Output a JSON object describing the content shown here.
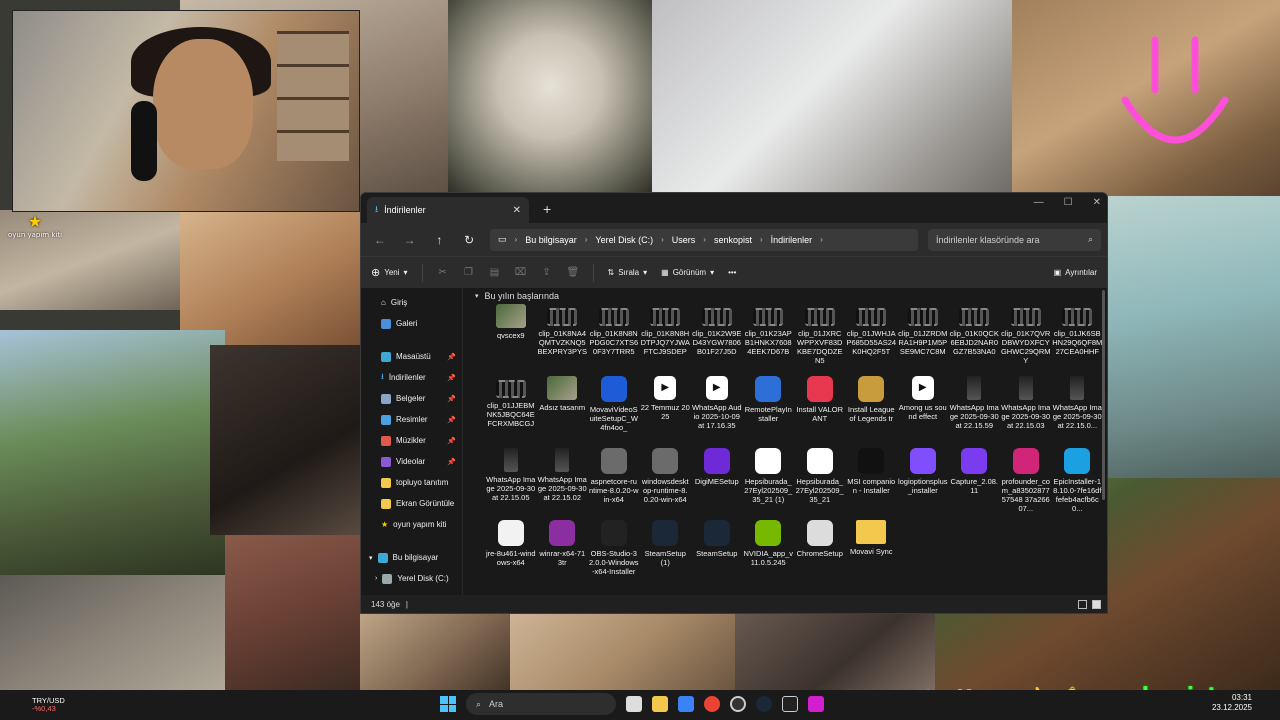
{
  "overlay": {
    "star_label": "oyun yapım kiti",
    "social_handle": "senkopist"
  },
  "window": {
    "tab_title": "İndirilenler",
    "address": [
      "Bu bilgisayar",
      "Yerel Disk (C:)",
      "Users",
      "senkopist",
      "İndirilenler"
    ],
    "search_placeholder": "İndirilenler klasöründe ara"
  },
  "toolbar": {
    "new_label": "Yeni",
    "sort_label": "Sırala",
    "view_label": "Görünüm",
    "more_label": "•••",
    "details_label": "Ayrıntılar"
  },
  "sidebar": {
    "items": [
      {
        "label": "Giriş",
        "icon": "home-icon"
      },
      {
        "label": "Galeri",
        "icon": "gallery-icon"
      },
      {
        "label": "Masaüstü",
        "icon": "desktop-icon",
        "pinned": true
      },
      {
        "label": "İndirilenler",
        "icon": "download-icon",
        "pinned": true
      },
      {
        "label": "Belgeler",
        "icon": "documents-icon",
        "pinned": true
      },
      {
        "label": "Resimler",
        "icon": "pictures-icon",
        "pinned": true
      },
      {
        "label": "Müzikler",
        "icon": "music-icon",
        "pinned": true
      },
      {
        "label": "Videolar",
        "icon": "videos-icon",
        "pinned": true
      },
      {
        "label": "topluyo tanıtım",
        "icon": "folder-icon"
      },
      {
        "label": "Ekran Görüntüle",
        "icon": "folder-icon"
      },
      {
        "label": "oyun yapım kiti",
        "icon": "star-icon"
      },
      {
        "label": "Bu bilgisayar",
        "icon": "computer-icon"
      },
      {
        "label": "Yerel Disk (C:)",
        "icon": "drive-icon"
      }
    ]
  },
  "files": {
    "group_header": "Bu yılın başlarında",
    "items": [
      {
        "name": "qvscex9",
        "type": "photo"
      },
      {
        "name": "clip_01K8NA4QMTVZKNQ5BEXPRY3PYS",
        "type": "video"
      },
      {
        "name": "clip_01K8N8NPDG0C7XTS60F3Y7TRR5",
        "type": "video"
      },
      {
        "name": "clip_01K8N8HDTPJQ7YJWAFTCJ9SDEP",
        "type": "video"
      },
      {
        "name": "clip_01K2W9ED43YGW7806B01F27J5D",
        "type": "video"
      },
      {
        "name": "clip_01K23APB1HNKX76084EEK7D67B",
        "type": "video"
      },
      {
        "name": "clip_01JXRCWPPXVF83DKBE7DQDZEN5",
        "type": "video"
      },
      {
        "name": "clip_01JWHJAP685D55AS24K0HQ2F5T",
        "type": "video"
      },
      {
        "name": "clip_01JZRDMRA1H9P1M5PSE9MC7C8M",
        "type": "video"
      },
      {
        "name": "clip_01K0QCK6EBJD2NAR0GZ7B53NA0",
        "type": "video"
      },
      {
        "name": "clip_01K7QVRDBWYDXFCYGHWC29QRMY",
        "type": "video"
      },
      {
        "name": "clip_01JK6SBHN29Q6QF8M27CEA0HHF",
        "type": "video"
      },
      {
        "name": "clip_01JJEBMNK5JBQC64EFCRXMBCGJ",
        "type": "video"
      },
      {
        "name": "Adsız tasarım",
        "type": "photo"
      },
      {
        "name": "MovaviVideoSuiteSetupC_W4fn4oo_",
        "type": "app",
        "color": "#1e5bd6"
      },
      {
        "name": "22 Temmuz 2025",
        "type": "play"
      },
      {
        "name": "WhatsApp Audio 2025-10-09 at 17.16.35",
        "type": "play"
      },
      {
        "name": "RemotePlayInstaller",
        "type": "app",
        "color": "#2d6fd6"
      },
      {
        "name": "Install VALORANT",
        "type": "app",
        "color": "#e8384f"
      },
      {
        "name": "Install League of Legends tr",
        "type": "app",
        "color": "#c89b3c"
      },
      {
        "name": "Among us sound effect",
        "type": "play"
      },
      {
        "name": "WhatsApp Image 2025-09-30 at 22.15.59",
        "type": "phone"
      },
      {
        "name": "WhatsApp Image 2025-09-30 at 22.15.03",
        "type": "phone"
      },
      {
        "name": "WhatsApp Image 2025-09-30 at 22.15.0...",
        "type": "phone"
      },
      {
        "name": "WhatsApp Image 2025-09-30 at 22.15.05",
        "type": "phone"
      },
      {
        "name": "WhatsApp Image 2025-09-30 at 22.15.02",
        "type": "phone"
      },
      {
        "name": "aspnetcore-runtime-8.0.20-win-x64",
        "type": "app",
        "color": "#6b6b6b"
      },
      {
        "name": "windowsdesktop-runtime-8.0.20-win-x64",
        "type": "app",
        "color": "#6b6b6b"
      },
      {
        "name": "DigiMESetup",
        "type": "app",
        "color": "#6d2ad6"
      },
      {
        "name": "Hepsiburada_27Eyl202509_35_21 (1)",
        "type": "app",
        "color": "#ffffff"
      },
      {
        "name": "Hepsiburada_27Eyl202509_35_21",
        "type": "app",
        "color": "#ffffff"
      },
      {
        "name": "MSI companion - Installer",
        "type": "app",
        "color": "#111111"
      },
      {
        "name": "logioptionsplus_installer",
        "type": "app",
        "color": "#814eff"
      },
      {
        "name": "Capture_2.08.11",
        "type": "app",
        "color": "#7b3cf0"
      },
      {
        "name": "profounder_com_a8350287757548 37a26607...",
        "type": "app",
        "color": "#d1257a"
      },
      {
        "name": "EpicInstaller-18.10.0-7fe16dffefeb4acfb6c0...",
        "type": "app",
        "color": "#1ba1e2"
      },
      {
        "name": "jre-8u461-windows-x64",
        "type": "app",
        "color": "#f2f2f2"
      },
      {
        "name": "winrar-x64-713tr",
        "type": "app",
        "color": "#8b2fa0"
      },
      {
        "name": "OBS-Studio-32.0.0-Windows-x64-Installer",
        "type": "app",
        "color": "#222222"
      },
      {
        "name": "SteamSetup (1)",
        "type": "app",
        "color": "#1b2838"
      },
      {
        "name": "SteamSetup",
        "type": "app",
        "color": "#1b2838"
      },
      {
        "name": "NVIDIA_app_v11.0.5.245",
        "type": "app",
        "color": "#76b900"
      },
      {
        "name": "ChromeSetup",
        "type": "app",
        "color": "#dcdcdc"
      },
      {
        "name": "Movavi Sync",
        "type": "folder",
        "color": "#f2c94c"
      }
    ]
  },
  "status": {
    "item_count": "143 öğe",
    "divider": "|"
  },
  "taskbar": {
    "ticker_symbol": "TRY/USD",
    "ticker_change": "-%0,43",
    "search_label": "Ara",
    "time": "03:31",
    "date": "23.12.2025"
  }
}
